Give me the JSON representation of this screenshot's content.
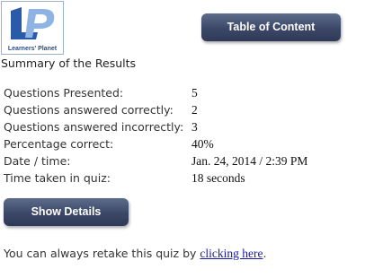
{
  "logo": {
    "monogram": "LP",
    "caption": "Learners' Planet",
    "colors": {
      "primary": "#2a5aa8",
      "light": "#8fb4e3"
    }
  },
  "header": {
    "toc_label": "Table of Content"
  },
  "summary": {
    "heading": "Summary of the Results",
    "rows": [
      {
        "label": "Questions Presented:",
        "value": "5"
      },
      {
        "label": "Questions answered correctly:",
        "value": "2"
      },
      {
        "label": "Questions answered incorrectly:",
        "value": "3"
      },
      {
        "label": "Percentage correct:",
        "value": "40%"
      },
      {
        "label": "Date / time:",
        "value": "Jan. 24, 2014 / 2:39 PM"
      },
      {
        "label": "Time taken in quiz:",
        "value": "18 seconds"
      }
    ]
  },
  "details_button": {
    "label": "Show Details"
  },
  "retake": {
    "prefix": "You can always retake this quiz by ",
    "link_text": "clicking here",
    "suffix": "."
  },
  "theme": {
    "button_color": "#3b4766",
    "link_color": "#1a1aa6"
  }
}
